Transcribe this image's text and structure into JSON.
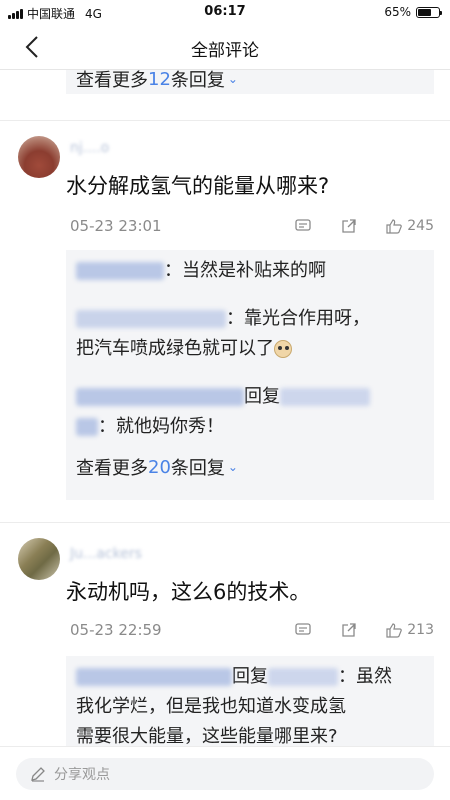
{
  "status_bar": {
    "carrier": "中国联通",
    "network": "4G",
    "time": "06:17",
    "battery": "65%",
    "battery_level": 0.65
  },
  "nav": {
    "title": "全部评论"
  },
  "top_reply_box": {
    "more_prefix": "查看更多",
    "more_count": "12",
    "more_suffix": "条回复"
  },
  "comments": [
    {
      "username": "nj....o",
      "text": "水分解成氢气的能量从哪来?",
      "date": "05-23 23:01",
      "likes": "245",
      "replies": [
        {
          "text": "：当然是补贴来的啊"
        },
        {
          "text": "：靠光合作用呀，",
          "text2": "把汽车喷成绿色就可以了"
        },
        {
          "reply_word": "回复",
          "text": "：就他妈你秀！"
        }
      ],
      "more_prefix": "查看更多",
      "more_count": "20",
      "more_suffix": "条回复"
    },
    {
      "username": "Ju...ackers",
      "text": "永动机吗，这么6的技术。",
      "date": "05-23 22:59",
      "likes": "213",
      "replies": [
        {
          "reply_word": "回复",
          "text": "：虽然",
          "text2": "我化学烂，但是我也知道水变成氢",
          "text3": "需要很大能量，这些能量哪里来?"
        }
      ]
    }
  ],
  "bottom": {
    "placeholder": "分享观点"
  },
  "colors": {
    "accent": "#4a83e6",
    "reply_bg": "#f4f5f7"
  }
}
